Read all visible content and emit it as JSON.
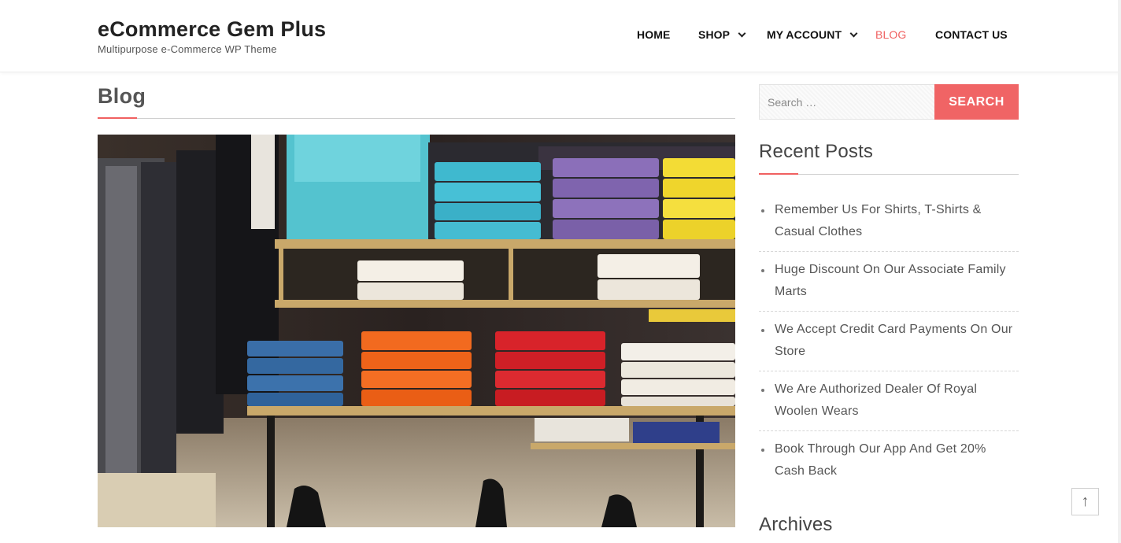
{
  "site": {
    "title": "eCommerce Gem Plus",
    "tagline": "Multipurpose e-Commerce WP Theme"
  },
  "nav": {
    "items": [
      {
        "label": "HOME",
        "active": false,
        "has_submenu": false
      },
      {
        "label": "SHOP",
        "active": false,
        "has_submenu": true
      },
      {
        "label": "MY ACCOUNT",
        "active": false,
        "has_submenu": true
      },
      {
        "label": "BLOG",
        "active": true,
        "has_submenu": false
      },
      {
        "label": "CONTACT US",
        "active": false,
        "has_submenu": false
      }
    ]
  },
  "main": {
    "heading": "Blog"
  },
  "sidebar": {
    "search": {
      "placeholder": "Search …",
      "button_label": "SEARCH"
    },
    "recent_posts": {
      "title": "Recent Posts",
      "items": [
        "Remember Us For Shirts, T-Shirts & Casual Clothes",
        "Huge Discount On Our Associate Family Marts",
        "We Accept Credit Card Payments On Our Store",
        "We Are Authorized Dealer Of Royal Woolen Wears",
        "Book Through Our App And Get 20% Cash Back"
      ]
    },
    "archives": {
      "title": "Archives"
    }
  },
  "scroll_top": {
    "icon": "arrow-up-icon",
    "glyph": "↑"
  },
  "colors": {
    "accent": "#f06060",
    "search_button": "#f06465",
    "text_dark": "#222222"
  }
}
